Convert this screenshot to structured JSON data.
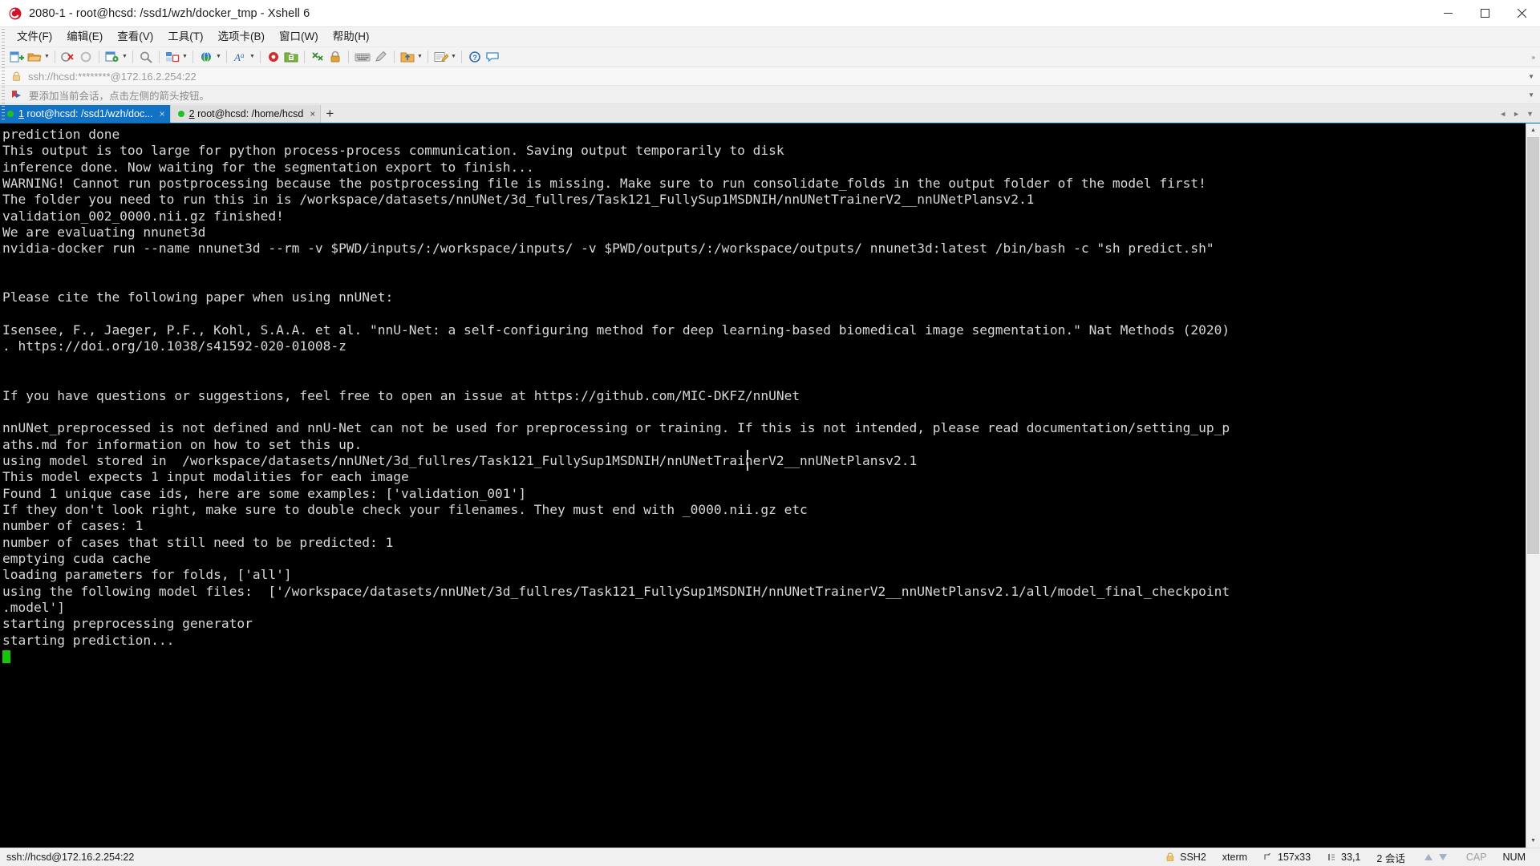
{
  "window": {
    "title": "2080-1 - root@hcsd: /ssd1/wzh/docker_tmp - Xshell 6",
    "app_icon": "xshell-icon",
    "minimize_label": "—",
    "maximize_label": "☐",
    "close_label": "✕"
  },
  "menu": {
    "items": [
      {
        "label": "文件(F)",
        "name": "menu-file"
      },
      {
        "label": "编辑(E)",
        "name": "menu-edit"
      },
      {
        "label": "查看(V)",
        "name": "menu-view"
      },
      {
        "label": "工具(T)",
        "name": "menu-tools"
      },
      {
        "label": "选项卡(B)",
        "name": "menu-tabs"
      },
      {
        "label": "窗口(W)",
        "name": "menu-window"
      },
      {
        "label": "帮助(H)",
        "name": "menu-help"
      }
    ]
  },
  "toolbar": {
    "overflow_label": "»",
    "buttons": [
      {
        "name": "new-session-button",
        "icon": "new-file-icon",
        "caret": false
      },
      {
        "name": "open-session-button",
        "icon": "folder-icon",
        "caret": true
      },
      {
        "name": "disconnect-button",
        "icon": "disconnect-icon",
        "caret": false
      },
      {
        "name": "reconnect-button",
        "icon": "reconnect-icon",
        "caret": false
      },
      {
        "name": "session-properties-button",
        "icon": "properties-gear-icon",
        "caret": true
      },
      {
        "name": "find-button",
        "icon": "search-icon",
        "caret": false
      },
      {
        "name": "layout-button",
        "icon": "layout-icon",
        "caret": true
      },
      {
        "name": "web-transfer-button",
        "icon": "globe-icon",
        "caret": true
      },
      {
        "name": "font-button",
        "icon": "font-icon",
        "caret": true
      },
      {
        "name": "record-button",
        "icon": "record-icon",
        "caret": false
      },
      {
        "name": "log-button",
        "icon": "log-folder-icon",
        "caret": false
      },
      {
        "name": "sync-button",
        "icon": "sync-icon",
        "caret": false
      },
      {
        "name": "lock-button",
        "icon": "lock-icon",
        "caret": false
      },
      {
        "name": "keyboard-button",
        "icon": "keyboard-icon",
        "caret": false
      },
      {
        "name": "highlight-button",
        "icon": "pen-icon",
        "caret": false
      },
      {
        "name": "transfer-button",
        "icon": "transfer-icon",
        "caret": true
      },
      {
        "name": "compose-button",
        "icon": "compose-icon",
        "caret": true
      },
      {
        "name": "help-button",
        "icon": "help-icon",
        "caret": false
      },
      {
        "name": "chat-button",
        "icon": "chat-icon",
        "caret": false
      }
    ]
  },
  "address": {
    "icon": "lock-icon",
    "value": "ssh://hcsd:********@172.16.2.254:22",
    "caret": "▼"
  },
  "notice": {
    "icon": "bookmark-arrow-icon",
    "text": "要添加当前会话，点击左侧的箭头按钮。",
    "caret": "▼"
  },
  "tabs": {
    "items": [
      {
        "name": "tab-session-1",
        "index": "1",
        "label": " root@hcsd: /ssd1/wzh/doc...",
        "active": true,
        "close": "×"
      },
      {
        "name": "tab-session-2",
        "index": "2",
        "label": " root@hcsd: /home/hcsd",
        "active": false,
        "close": "×"
      }
    ],
    "add_label": "+",
    "nav_left": "◄",
    "nav_right": "►",
    "nav_menu": "▼"
  },
  "terminal": {
    "lines": [
      "prediction done",
      "This output is too large for python process-process communication. Saving output temporarily to disk",
      "inference done. Now waiting for the segmentation export to finish...",
      "WARNING! Cannot run postprocessing because the postprocessing file is missing. Make sure to run consolidate_folds in the output folder of the model first!",
      "The folder you need to run this in is /workspace/datasets/nnUNet/3d_fullres/Task121_FullySup1MSDNIH/nnUNetTrainerV2__nnUNetPlansv2.1",
      "validation_002_0000.nii.gz finished!",
      "We are evaluating nnunet3d",
      "nvidia-docker run --name nnunet3d --rm -v $PWD/inputs/:/workspace/inputs/ -v $PWD/outputs/:/workspace/outputs/ nnunet3d:latest /bin/bash -c \"sh predict.sh\"",
      "",
      "",
      "Please cite the following paper when using nnUNet:",
      "",
      "Isensee, F., Jaeger, P.F., Kohl, S.A.A. et al. \"nnU-Net: a self-configuring method for deep learning-based biomedical image segmentation.\" Nat Methods (2020)",
      ". https://doi.org/10.1038/s41592-020-01008-z",
      "",
      "",
      "If you have questions or suggestions, feel free to open an issue at https://github.com/MIC-DKFZ/nnUNet",
      "",
      "nnUNet_preprocessed is not defined and nnU-Net can not be used for preprocessing or training. If this is not intended, please read documentation/setting_up_p",
      "aths.md for information on how to set this up.",
      "using model stored in  /workspace/datasets/nnUNet/3d_fullres/Task121_FullySup1MSDNIH/nnUNetTrainerV2__nnUNetPlansv2.1",
      "This model expects 1 input modalities for each image",
      "Found 1 unique case ids, here are some examples: ['validation_001']",
      "If they don't look right, make sure to double check your filenames. They must end with _0000.nii.gz etc",
      "number of cases: 1",
      "number of cases that still need to be predicted: 1",
      "emptying cuda cache",
      "loading parameters for folds, ['all']",
      "using the following model files:  ['/workspace/datasets/nnUNet/3d_fullres/Task121_FullySup1MSDNIH/nnUNetTrainerV2__nnUNetPlansv2.1/all/model_final_checkpoint",
      ".model']",
      "starting preprocessing generator",
      "starting prediction..."
    ],
    "cursor_visible": true,
    "background": "#000000",
    "foreground": "#d8d8d8",
    "cursor_color": "#16c60c"
  },
  "statusbar": {
    "connection": "ssh://hcsd@172.16.2.254:22",
    "protocol": "SSH2",
    "terminal_type": "xterm",
    "size": "157x33",
    "cursor_pos": "33,1",
    "sessions": "2 会话",
    "cap": "CAP",
    "num": "NUM"
  }
}
